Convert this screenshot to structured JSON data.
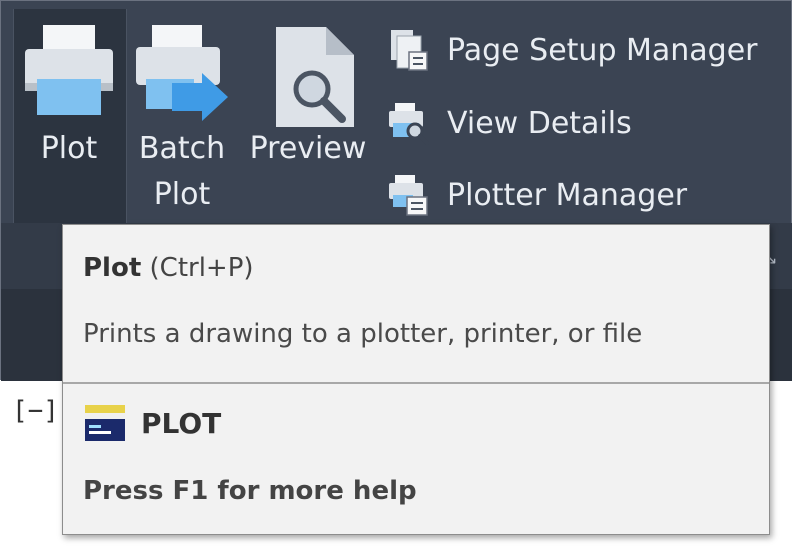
{
  "ribbon": {
    "plot": {
      "label": "Plot",
      "icon": "printer-icon"
    },
    "batch_plot": {
      "label_line1": "Batch",
      "label_line2": "Plot",
      "icon": "batch-plot-icon"
    },
    "preview": {
      "label": "Preview",
      "icon": "preview-icon"
    },
    "page_setup_manager": {
      "label": "Page Setup Manager",
      "icon": "page-setup-icon"
    },
    "view_details": {
      "label": "View Details",
      "icon": "view-details-icon"
    },
    "plotter_manager": {
      "label": "Plotter Manager",
      "icon": "plotter-manager-icon"
    },
    "panel_expand_icon": "dialog-launcher-icon"
  },
  "drawing": {
    "viewport_control": "[−]"
  },
  "tooltip": {
    "name": "Plot",
    "shortcut": "(Ctrl+P)",
    "description": "Prints a drawing to a plotter, printer, or file",
    "command_icon": "command-line-icon",
    "command": "PLOT",
    "help": "Press F1 for more help"
  },
  "colors": {
    "ribbon_bg": "#3b4453",
    "ribbon_text": "#e9edf2",
    "tooltip_bg": "#f2f2f2",
    "accent_blue": "#4aa3e6"
  }
}
